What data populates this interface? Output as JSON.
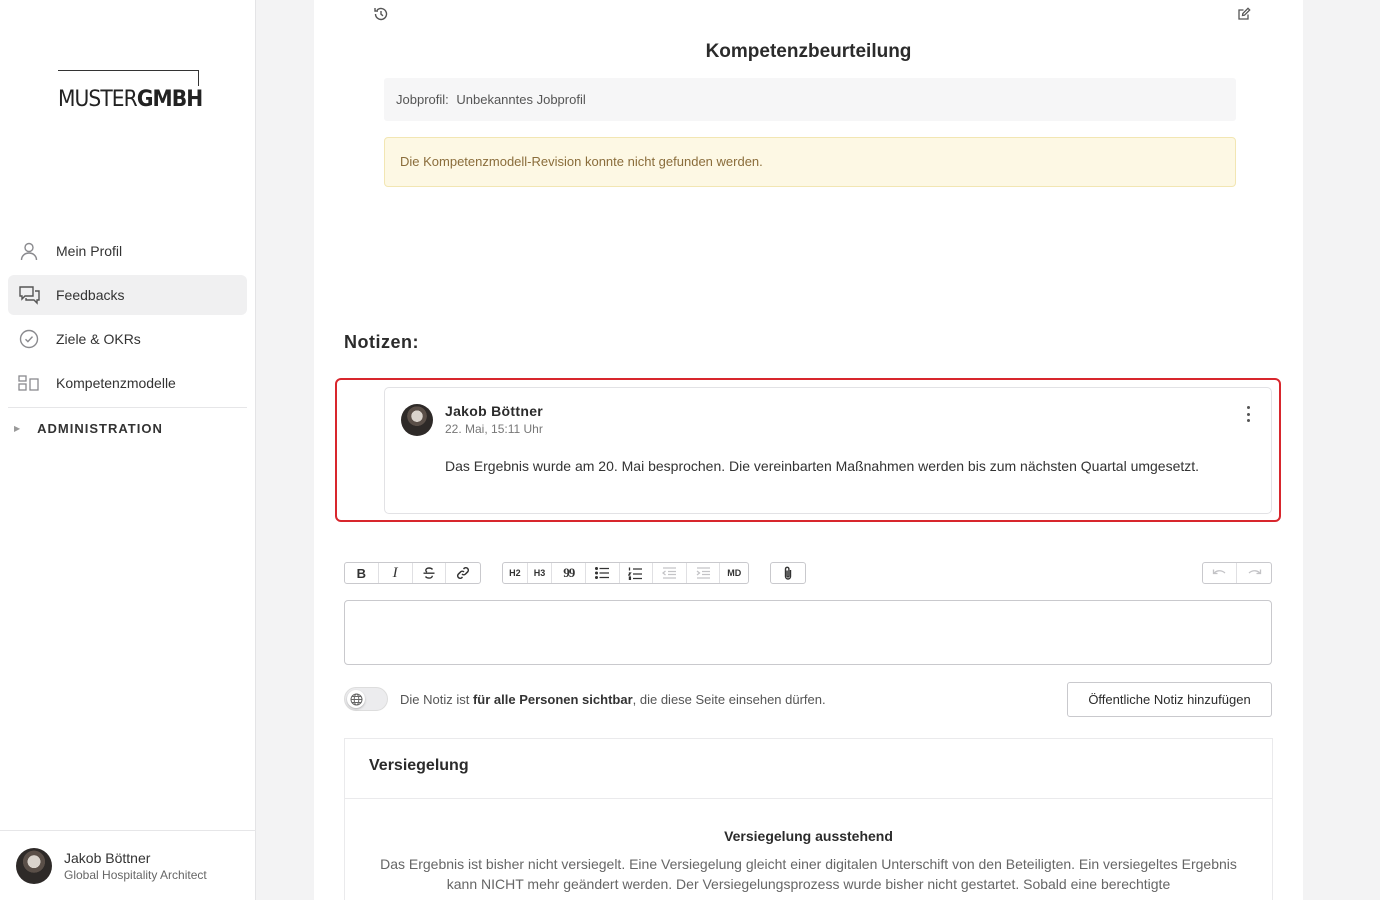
{
  "brand": {
    "logo_light": "MUSTER",
    "logo_bold": "GMBH"
  },
  "sidebar": {
    "items": [
      {
        "label": "Mein Profil",
        "icon": "user-icon"
      },
      {
        "label": "Feedbacks",
        "icon": "chat-icon"
      },
      {
        "label": "Ziele & OKRs",
        "icon": "check-circle-icon"
      },
      {
        "label": "Kompetenzmodelle",
        "icon": "grid-icon"
      }
    ],
    "admin_label": "ADMINISTRATION"
  },
  "user": {
    "name": "Jakob Böttner",
    "role": "Global Hospitality Architect"
  },
  "main": {
    "title": "Kompetenzbeurteilung",
    "jobprofil_label": "Jobprofil:",
    "jobprofil_value": "Unbekanntes Jobprofil",
    "alert": "Die Kompetenzmodell-Revision konnte nicht gefunden werden."
  },
  "notes": {
    "title": "Notizen:",
    "items": [
      {
        "author": "Jakob Böttner",
        "date": "22. Mai, 15:11 Uhr",
        "text": "Das Ergebnis wurde am 20. Mai besprochen. Die vereinbarten Maßnahmen werden bis zum nächsten Quartal umgesetzt."
      }
    ]
  },
  "toolbar": {
    "bold": "B",
    "italic": "I",
    "h2": "H2",
    "h3": "H3",
    "quote": "99",
    "md": "MD"
  },
  "visibility": {
    "prefix": "Die Notiz ist ",
    "bold": "für alle Personen sichtbar",
    "suffix": ", die diese Seite einsehen dürfen."
  },
  "add_button": "Öffentliche Notiz hinzufügen",
  "seal": {
    "title": "Versiegelung",
    "status": "Versiegelung ausstehend",
    "text": "Das Ergebnis ist bisher nicht versiegelt. Eine Versiegelung gleicht einer digitalen Unterschift von den Beteiligten. Ein versiegeltes Ergebnis kann NICHT mehr geändert werden. Der Versiegelungsprozess wurde bisher nicht gestartet. Sobald eine berechtigte"
  },
  "colors": {
    "highlight": "#d8262d",
    "alert_bg": "#fdf8e4",
    "alert_text": "#8a6d3b"
  }
}
